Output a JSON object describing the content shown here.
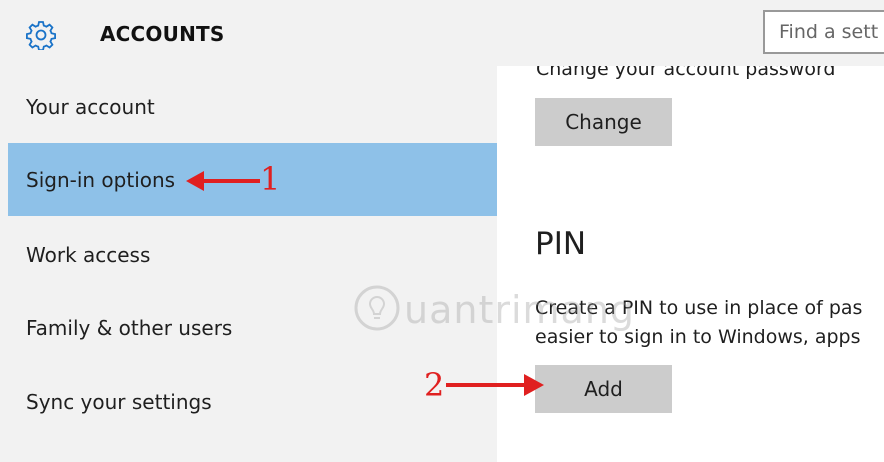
{
  "header": {
    "title": "ACCOUNTS",
    "search_placeholder": "Find a sett"
  },
  "sidebar": {
    "items": [
      {
        "label": "Your account"
      },
      {
        "label": "Sign-in options",
        "active": true
      },
      {
        "label": "Work access"
      },
      {
        "label": "Family & other users"
      },
      {
        "label": "Sync your settings"
      }
    ]
  },
  "content": {
    "password_text": "Change your account password",
    "change_label": "Change",
    "pin_heading": "PIN",
    "pin_desc_line1": "Create a PIN to use in place of pas",
    "pin_desc_line2": "easier to sign in to Windows, apps",
    "add_label": "Add"
  },
  "annotations": {
    "step1": "1",
    "step2": "2"
  },
  "watermark": "uantrimang",
  "colors": {
    "accent_selected": "#8ec1e8",
    "sidebar_bg": "#f2f2f2",
    "button_bg": "#cccccc",
    "annotation_red": "#e02020",
    "gear_icon": "#1a73c8"
  },
  "icons": {
    "settings": "gear-icon",
    "watermark": "lightbulb-icon"
  }
}
